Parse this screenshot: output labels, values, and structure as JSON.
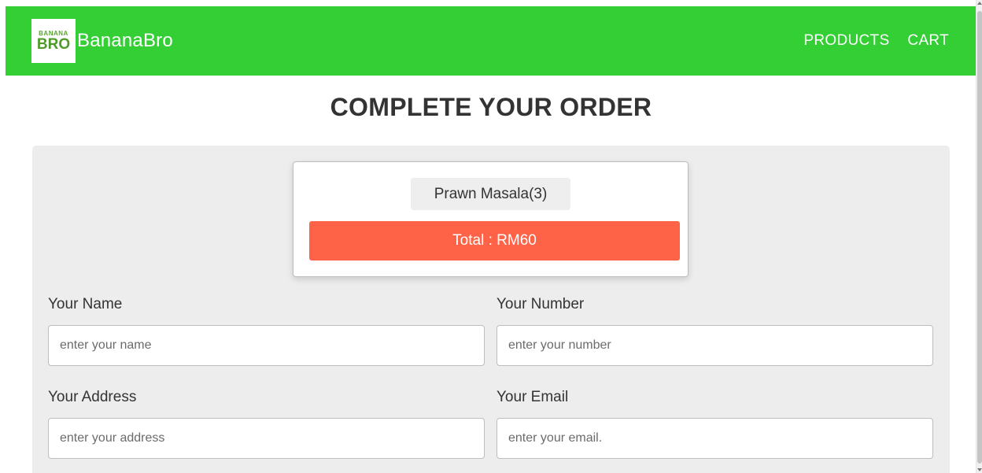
{
  "header": {
    "logo_top": "BANANA",
    "logo_bottom": "BRO",
    "brand": "BananaBro",
    "nav": [
      "PRODUCTS",
      "CART"
    ]
  },
  "page": {
    "title": "COMPLETE YOUR ORDER"
  },
  "order": {
    "item": "Prawn Masala(3)",
    "total": "Total : RM60"
  },
  "form": {
    "name": {
      "label": "Your Name",
      "placeholder": "enter your name",
      "value": ""
    },
    "number": {
      "label": "Your Number",
      "placeholder": "enter your number",
      "value": ""
    },
    "address": {
      "label": "Your Address",
      "placeholder": "enter your address",
      "value": ""
    },
    "email": {
      "label": "Your Email",
      "placeholder": "enter your email.",
      "value": ""
    }
  },
  "colors": {
    "header": "#34cf35",
    "total_bar": "#ff6347",
    "panel": "#ededed"
  }
}
